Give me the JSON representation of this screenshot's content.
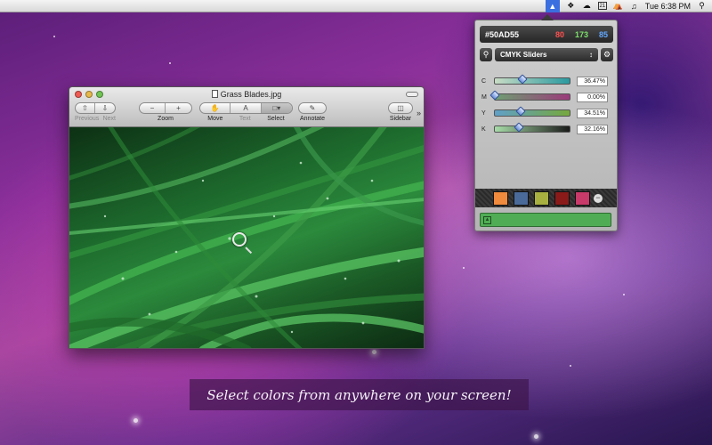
{
  "menubar": {
    "icons": [
      "color-picker-icon",
      "dropbox-icon",
      "cloud-icon",
      "calendar-icon",
      "wifi-icon",
      "volume-icon"
    ],
    "calendar_day": "21",
    "clock": "Tue 6:38 PM"
  },
  "picker": {
    "hex": "#50AD55",
    "r": "80",
    "g": "173",
    "b": "85",
    "color": "#50AD55",
    "mode_label": "CMYK Sliders",
    "sliders": [
      {
        "label": "C",
        "value": "36.47%",
        "fraction": 0.3647,
        "from": "#c8dcc4",
        "to": "#2a9aa0"
      },
      {
        "label": "M",
        "value": "0.00%",
        "fraction": 0.0,
        "from": "#6e9f72",
        "to": "#9b3a7a"
      },
      {
        "label": "Y",
        "value": "34.51%",
        "fraction": 0.3451,
        "from": "#5fa0c8",
        "to": "#76a83c"
      },
      {
        "label": "K",
        "value": "32.16%",
        "fraction": 0.3216,
        "from": "#a7dca8",
        "to": "#1a1a1a"
      }
    ],
    "swatches": [
      "#f08a3c",
      "#4a6a9a",
      "#a8b040",
      "#8a1a1a",
      "#c83a6a"
    ]
  },
  "window": {
    "title": "Grass Blades.jpg",
    "toolbar": {
      "previous": "Previous",
      "next": "Next",
      "zoom": "Zoom",
      "move": "Move",
      "text": "Text",
      "select": "Select",
      "annotate": "Annotate",
      "sidebar": "Sidebar",
      "more": "»"
    }
  },
  "caption": "Select colors from anywhere on your screen!"
}
